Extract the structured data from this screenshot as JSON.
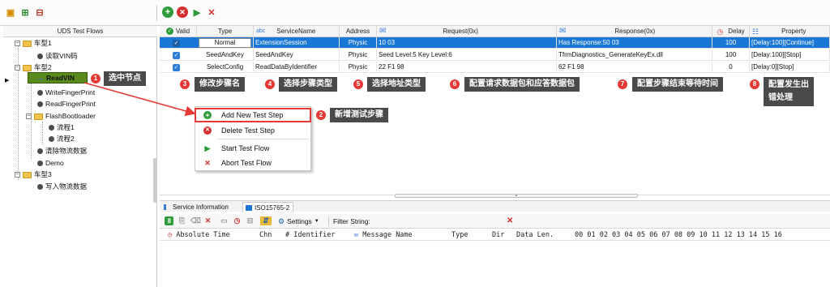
{
  "tree": {
    "header": "UDS Test Flows",
    "nodes": [
      {
        "label": "车型1",
        "kind": "folder"
      },
      {
        "label": "读取VIN码",
        "kind": "leaf"
      },
      {
        "label": "车型2",
        "kind": "folder"
      },
      {
        "label": "ReadVIN",
        "kind": "arrow"
      },
      {
        "label": "WriteFingerPrint",
        "kind": "leaf"
      },
      {
        "label": "ReadFingerPrint",
        "kind": "leaf"
      },
      {
        "label": "FlashBootloader",
        "kind": "folder"
      },
      {
        "label": "流程1",
        "kind": "leaf"
      },
      {
        "label": "流程2",
        "kind": "leaf"
      },
      {
        "label": "清除物流数据",
        "kind": "leaf"
      },
      {
        "label": "Demo",
        "kind": "leaf"
      },
      {
        "label": "车型3",
        "kind": "folder"
      },
      {
        "label": "写入物流数据",
        "kind": "leaf"
      }
    ]
  },
  "grid": {
    "headers": {
      "valid": "Valid",
      "type": "Type",
      "abc": "abc",
      "service": "ServiceName",
      "address": "Address",
      "request": "Request(0x)",
      "response": "Response(0x)",
      "delay": "Delay",
      "property": "Property"
    },
    "rows": [
      {
        "type": "Normal",
        "service": "ExtensionSession",
        "address": "Physic",
        "request": "10 03",
        "response": "Has Response:50 03",
        "delay": "100",
        "property": "[Delay:100][Continue]"
      },
      {
        "type": "SeedAndKey",
        "service": "SeedAndKey",
        "address": "Physic",
        "request": "Seed Level:5 Key Level:6",
        "response": "TfrmDiagnostics_GenerateKeyEx.dll",
        "delay": "100",
        "property": "[Delay:100][Stop]"
      },
      {
        "type": "SelectConfig",
        "service": "ReadDataByIdentifier",
        "address": "Physic",
        "request": "22 F1 98",
        "response": "62 F1 98",
        "delay": "0",
        "property": "[Delay:0][Stop]"
      }
    ]
  },
  "callouts": {
    "c1": {
      "num": "1",
      "text": "选中节点"
    },
    "c2": {
      "num": "2",
      "text": "新增测试步骤"
    },
    "c3": {
      "num": "3",
      "text": "修改步骤名"
    },
    "c4": {
      "num": "4",
      "text": "选择步骤类型"
    },
    "c5": {
      "num": "5",
      "text": "选择地址类型"
    },
    "c6": {
      "num": "6",
      "text": "配置请求数据包和应答数据包"
    },
    "c7": {
      "num": "7",
      "text": "配置步骤结束等待时间"
    },
    "c8": {
      "num": "8",
      "text": "配置发生出",
      "text2": "错处理"
    }
  },
  "context_menu": {
    "items": [
      "Add New Test Step",
      "Delete Test Step",
      "Start Test Flow",
      "Abort Test Flow"
    ]
  },
  "bottom": {
    "tabs": [
      "Service Information",
      "ISO15765-2"
    ],
    "settings_label": "Settings",
    "filter_label": "Filter String:",
    "columns": [
      "Absolute Time",
      "Chn",
      "Identifier",
      "Message Name",
      "Type",
      "Dir",
      "Data Len.",
      "00 01 02 03 04 05 06 07 08 09 10 11 12 13 14 15 16"
    ]
  },
  "colors": {
    "selected_row": "#1b77d6",
    "callout_bg": "#4a4a4a",
    "badge": "#e53935",
    "highlight_border": "#e53935"
  }
}
